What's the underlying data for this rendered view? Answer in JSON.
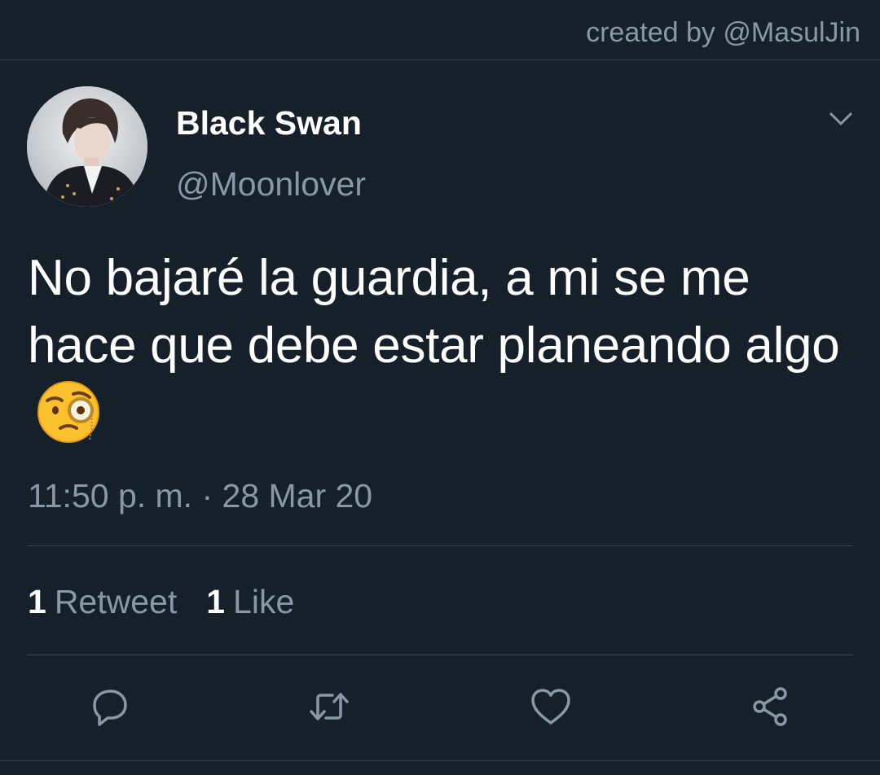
{
  "credit": "created by @MasulJin",
  "user": {
    "display_name": "Black Swan",
    "handle": "@Moonlover"
  },
  "tweet": {
    "text": "No bajaré la guardia, a mi se me hace que debe estar planeando algo",
    "emoji": "face-with-monocle",
    "timestamp": "11:50 p. m. · 28 Mar 20"
  },
  "stats": {
    "retweets_count": "1",
    "retweets_label": "Retweet",
    "likes_count": "1",
    "likes_label": "Like"
  },
  "actions": [
    "reply-icon",
    "retweet-icon",
    "like-icon",
    "share-icon"
  ],
  "colors": {
    "background": "#15202b",
    "secondary_text": "#8899a6",
    "divider": "#38444d"
  }
}
